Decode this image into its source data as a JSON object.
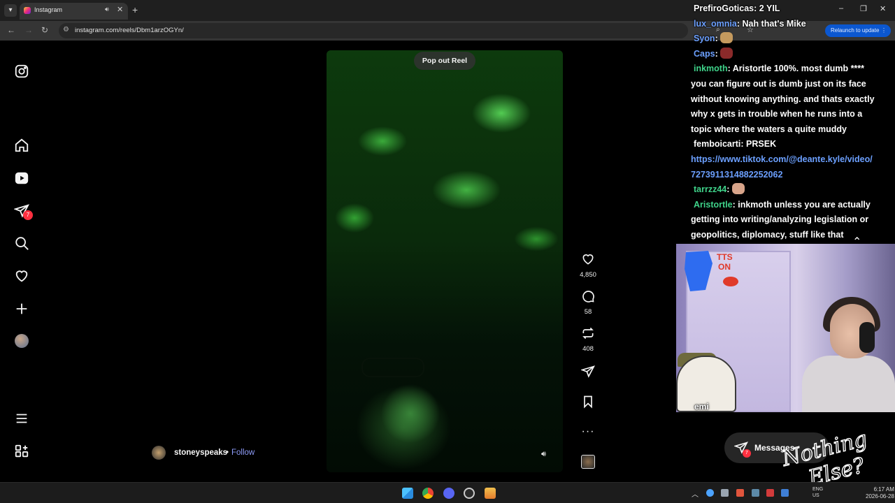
{
  "browser": {
    "tab_title": "Instagram",
    "url": "instagram.com/reels/Dbm1arzOGYn/",
    "relaunch_label": "Relaunch to update"
  },
  "reel": {
    "popout_label": "Pop out Reel",
    "likes": "4,850",
    "comments": "58",
    "reposts": "408",
    "author": "stoneyspeaks",
    "separator": "•",
    "follow_label": "Follow"
  },
  "sidebar": {
    "notification_count": "7"
  },
  "chat": [
    {
      "user": "PrefiroGoticas",
      "user_color": "#ffffff",
      "message": "2 YIL"
    },
    {
      "user": "lux_omnia",
      "user_color": "#6ca0ff",
      "message": "Nah that's Mike"
    },
    {
      "user": "Syon",
      "user_color": "#6ca0ff",
      "message": "",
      "emote": "cat-emote"
    },
    {
      "user": "Caps",
      "user_color": "#6ca0ff",
      "message": "",
      "emote": "ball-emote"
    },
    {
      "user": "inkmoth",
      "user_color": "#3fd38a",
      "message": "Aristortle 100%. most dumb ****"
    },
    {
      "user": "",
      "user_color": "#ffffff",
      "message": "you can figure out is dumb just on its face"
    },
    {
      "user": "",
      "user_color": "#ffffff",
      "message": "without knowing anything. and thats exactly"
    },
    {
      "user": "",
      "user_color": "#ffffff",
      "message": "why x gets in trouble when he runs into a"
    },
    {
      "user": "",
      "user_color": "#ffffff",
      "message": "topic where the waters a quite muddy"
    },
    {
      "user": "femboicarti",
      "user_color": "#ffffff",
      "message": "PRSEK"
    },
    {
      "user": "",
      "user_color": "#6ca0ff",
      "message": "https://www.tiktok.com/@deante.kyle/video/"
    },
    {
      "user": "",
      "user_color": "#6ca0ff",
      "message": "7273911314882252062"
    },
    {
      "user": "tarrzz44",
      "user_color": "#3fd38a",
      "message": "",
      "emote": "hands-emote"
    },
    {
      "user": "Aristortle",
      "user_color": "#3fd38a",
      "message": "inkmoth unless you are actually"
    },
    {
      "user": "",
      "user_color": "#ffffff",
      "message": "getting into writing/analyzing legislation or"
    },
    {
      "user": "",
      "user_color": "#ffffff",
      "message": "geopolitics, diplomacy, stuff like that"
    }
  ],
  "stream": {
    "tts_label_1": "TTS",
    "tts_label_2": "ON",
    "mascot_name": "emi",
    "logo_text_1": "Nothing",
    "logo_text_2": "Else?"
  },
  "messages": {
    "label": "Messages",
    "badge": "7"
  },
  "taskbar": {
    "lang_1": "ENG",
    "lang_2": "US",
    "time": "6:17 AM",
    "date": "2026-06-28"
  },
  "colors": {
    "accent_blue": "#0b57d0",
    "follow_link": "#8e9cf8",
    "badge_red": "#ff3040"
  }
}
